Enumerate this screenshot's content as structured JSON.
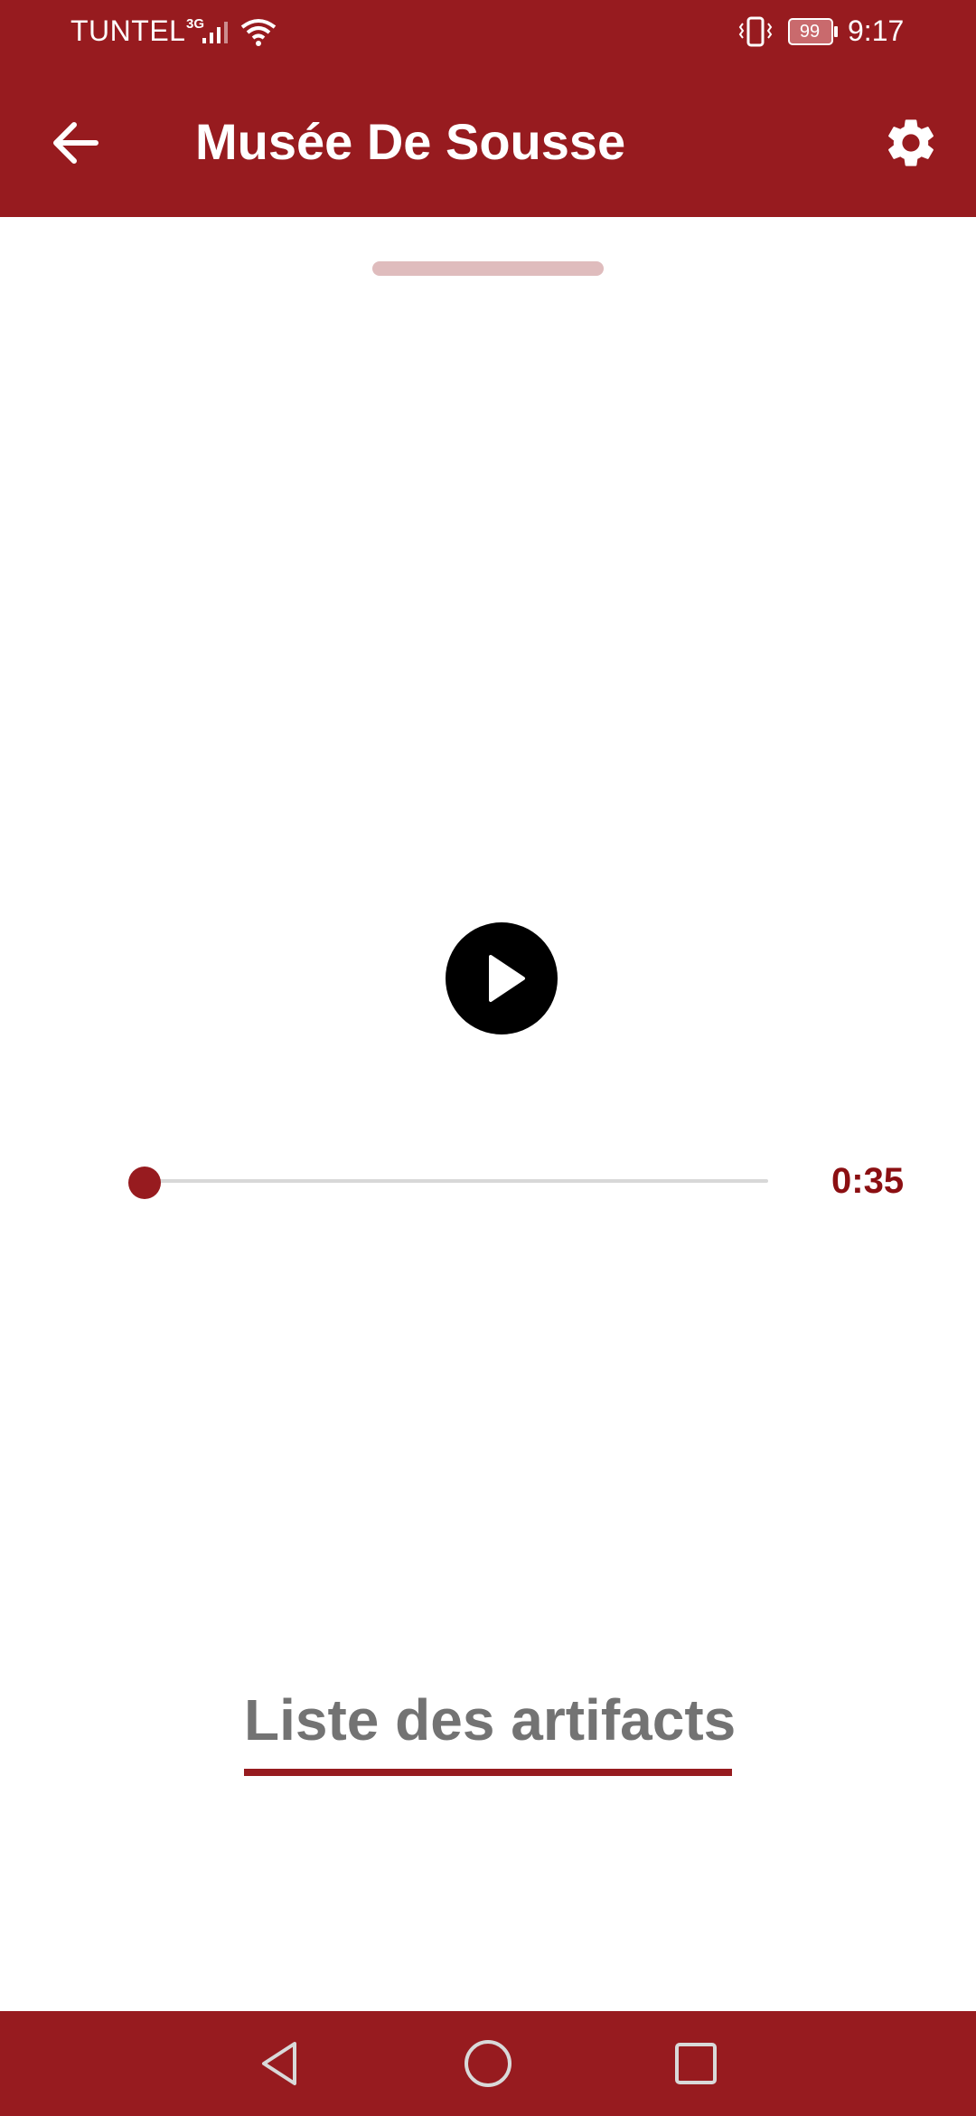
{
  "status_bar": {
    "carrier": "TUNTEL",
    "network_type": "3G",
    "battery_level": "99",
    "time": "9:17"
  },
  "app_bar": {
    "title": "Musée De Sousse",
    "back_icon": "arrow-left-icon",
    "settings_icon": "gear-icon",
    "background_color": "#971b1f"
  },
  "player": {
    "play_icon": "play-icon",
    "progress_fraction": 0,
    "duration": "0:35",
    "accent_color": "#971b1f"
  },
  "tabs": [
    {
      "label": "Liste des artifacts",
      "selected": true
    }
  ],
  "nav_bar": {
    "back_icon": "triangle-back-icon",
    "home_icon": "circle-home-icon",
    "recents_icon": "square-recents-icon"
  }
}
